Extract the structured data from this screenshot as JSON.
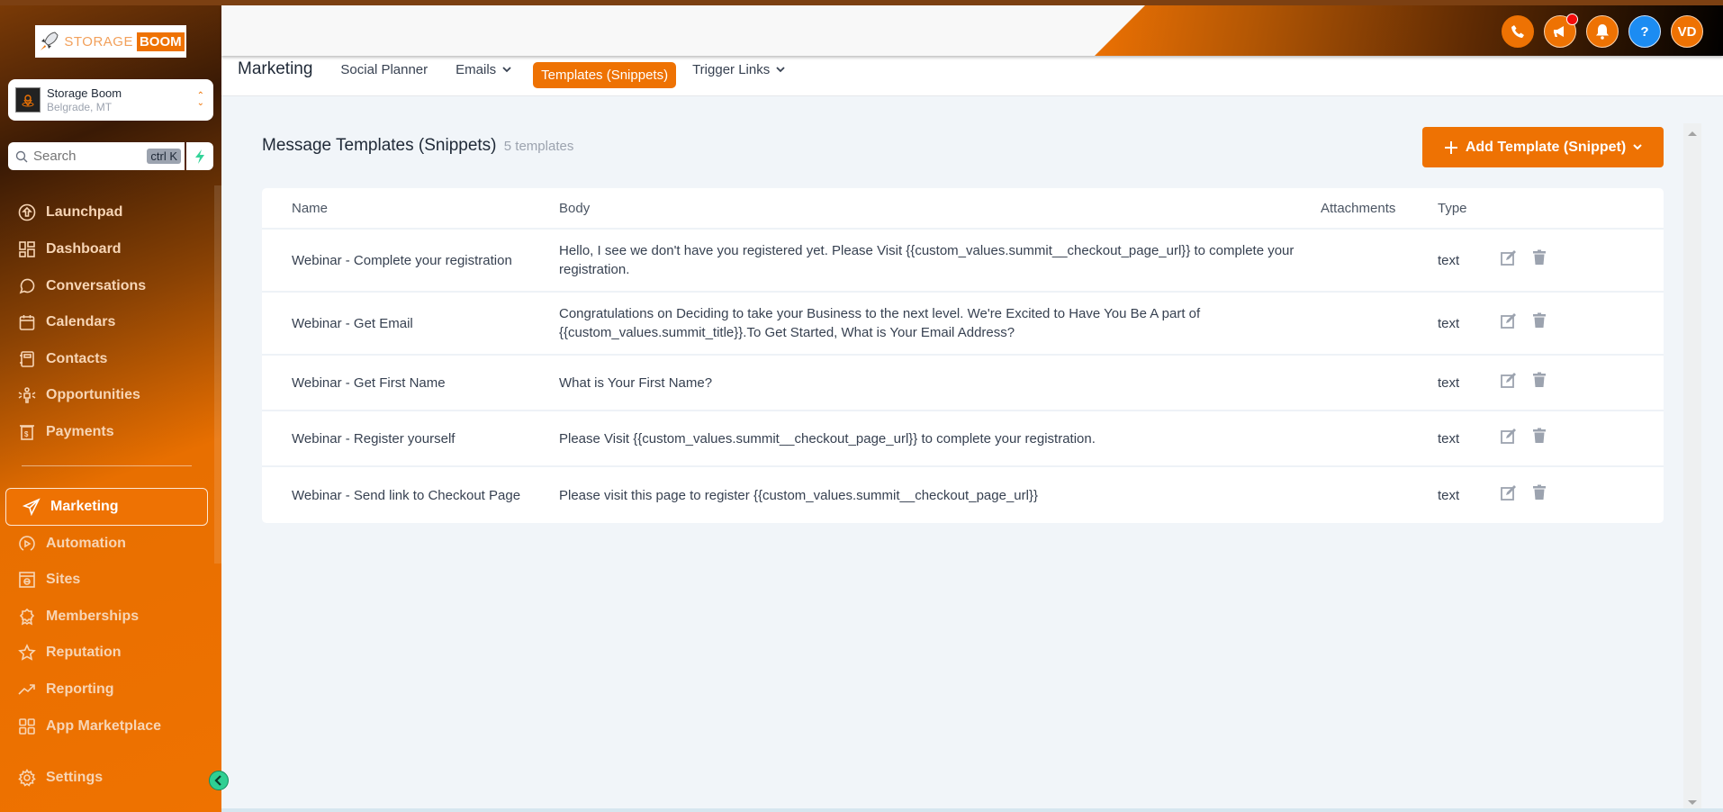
{
  "brand": {
    "logo_text_light": "STORAGE",
    "logo_text_bold": "BOOM",
    "accent": "#ee7203"
  },
  "location": {
    "name": "Storage Boom",
    "city": "Belgrade, MT"
  },
  "search": {
    "placeholder": "Search",
    "shortcut": "ctrl K"
  },
  "sidebar": {
    "items": [
      {
        "label": "Launchpad",
        "icon": "rocket-circle-icon"
      },
      {
        "label": "Dashboard",
        "icon": "grid-icon"
      },
      {
        "label": "Conversations",
        "icon": "chat-bubble-icon"
      },
      {
        "label": "Calendars",
        "icon": "calendar-icon"
      },
      {
        "label": "Contacts",
        "icon": "contact-book-icon"
      },
      {
        "label": "Opportunities",
        "icon": "opportunities-icon"
      },
      {
        "label": "Payments",
        "icon": "receipt-dollar-icon"
      },
      {
        "label": "Marketing",
        "icon": "send-icon",
        "active": true
      },
      {
        "label": "Automation",
        "icon": "play-circle-icon"
      },
      {
        "label": "Sites",
        "icon": "website-icon"
      },
      {
        "label": "Memberships",
        "icon": "award-icon"
      },
      {
        "label": "Reputation",
        "icon": "star-icon"
      },
      {
        "label": "Reporting",
        "icon": "trend-up-icon"
      },
      {
        "label": "App Marketplace",
        "icon": "apps-grid-icon"
      },
      {
        "label": "Settings",
        "icon": "gear-icon"
      }
    ]
  },
  "header": {
    "icons": [
      "phone-icon",
      "megaphone-icon",
      "bell-icon",
      "help-icon"
    ],
    "help_label": "?",
    "avatar_initials": "VD"
  },
  "subnav": {
    "title": "Marketing",
    "links": [
      {
        "label": "Social Planner",
        "dropdown": false
      },
      {
        "label": "Emails",
        "dropdown": true
      },
      {
        "label": "Templates (Snippets)",
        "dropdown": false,
        "active": true
      },
      {
        "label": "Trigger Links",
        "dropdown": true
      }
    ]
  },
  "main": {
    "title": "Message Templates (Snippets)",
    "count": "5 templates",
    "add_button": "Add Template (Snippet)",
    "columns": [
      "Name",
      "Body",
      "Attachments",
      "Type"
    ],
    "rows": [
      {
        "name": "Webinar - Complete your registration",
        "body": "Hello, I see we don't have you registered yet. Please Visit {{custom_values.summit__checkout_page_url}} to complete your registration.",
        "attachments": "",
        "type": "text"
      },
      {
        "name": "Webinar - Get Email",
        "body": "Congratulations on Deciding to take your Business to the next level. We're Excited to Have You Be A part of {{custom_values.summit_title}}.To Get Started, What is Your Email Address?",
        "attachments": "",
        "type": "text"
      },
      {
        "name": "Webinar - Get First Name",
        "body": "What is Your First Name?",
        "attachments": "",
        "type": "text"
      },
      {
        "name": "Webinar - Register yourself",
        "body": "Please Visit {{custom_values.summit__checkout_page_url}} to complete your registration.",
        "attachments": "",
        "type": "text"
      },
      {
        "name": "Webinar - Send link to Checkout Page",
        "body": "Please visit this page to register {{custom_values.summit__checkout_page_url}}",
        "attachments": "",
        "type": "text"
      }
    ]
  }
}
